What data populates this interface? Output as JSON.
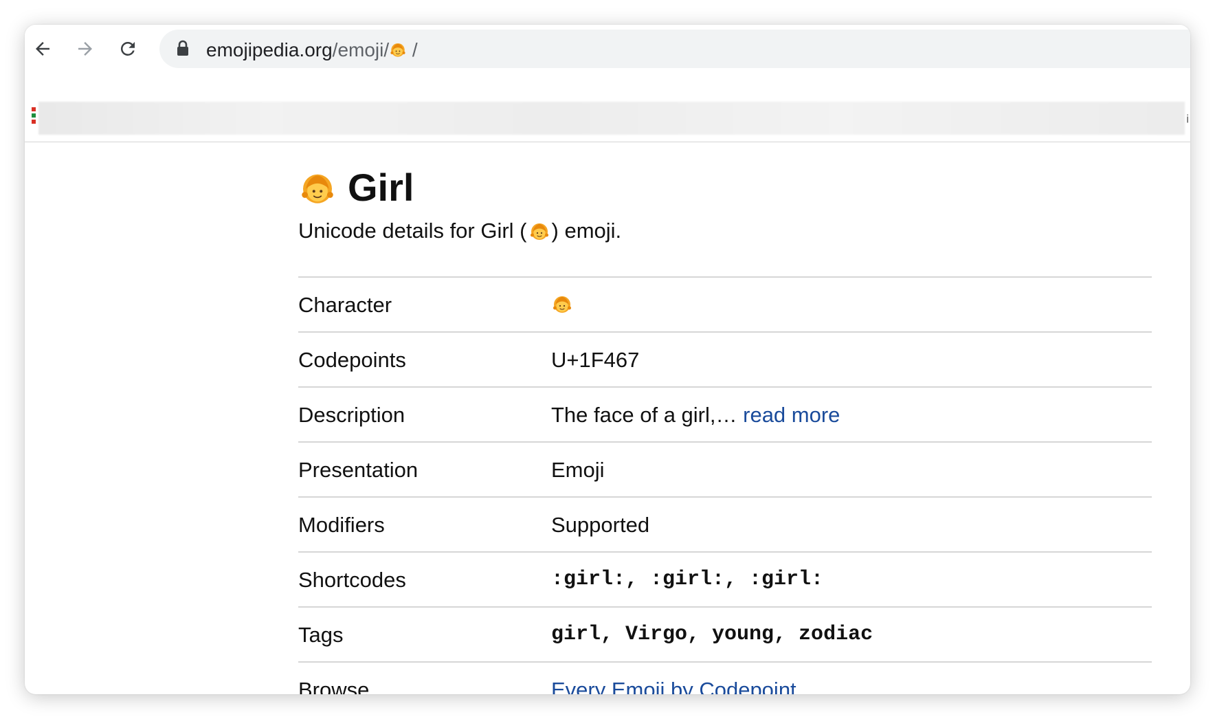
{
  "browser": {
    "url_host": "emojipedia.org",
    "url_path": "/emoji/",
    "url_emoji": "👧",
    "url_trailing": " /",
    "bookmark_edge_glyph": "ᵢ"
  },
  "page": {
    "title": "Girl",
    "emoji": "👧",
    "subtitle_before": "Unicode details for Girl (",
    "subtitle_after": " ) emoji."
  },
  "details": {
    "character_label": "Character",
    "character_value": "👧",
    "codepoints_label": "Codepoints",
    "codepoints_value": "U+1F467",
    "description_label": "Description",
    "description_value": "The face of a girl,… ",
    "description_link": "read more",
    "presentation_label": "Presentation",
    "presentation_value": "Emoji",
    "modifiers_label": "Modifiers",
    "modifiers_value": "Supported",
    "shortcodes_label": "Shortcodes",
    "shortcodes_value": ":girl:, :girl:, :girl:",
    "tags_label": "Tags",
    "tags_value": "girl, Virgo, young, zodiac",
    "browse_label": "Browse",
    "browse_link": "Every Emoji by Codepoint"
  },
  "colors": {
    "link": "#1a4b9b",
    "divider": "#d6d6d6",
    "omnibox_bg": "#f1f3f4"
  },
  "icons": [
    "back-arrow-icon",
    "forward-arrow-icon",
    "reload-icon",
    "lock-icon",
    "girl-emoji-icon",
    "apps-grid-icon"
  ]
}
